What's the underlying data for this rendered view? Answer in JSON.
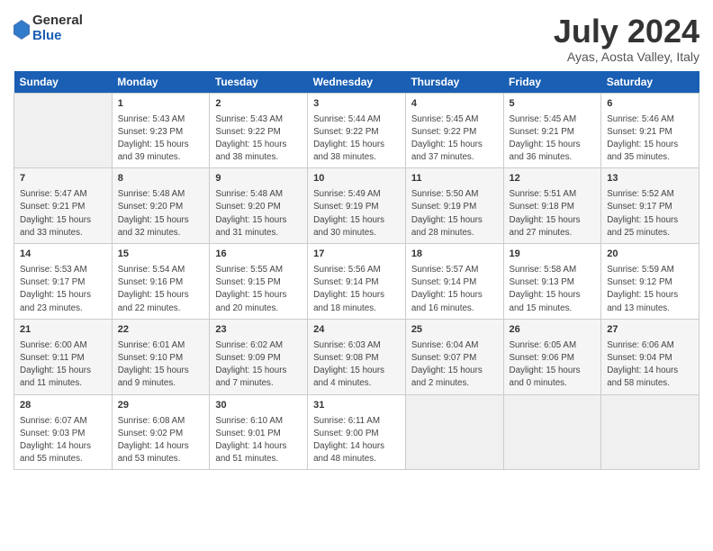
{
  "header": {
    "logo_general": "General",
    "logo_blue": "Blue",
    "title": "July 2024",
    "subtitle": "Ayas, Aosta Valley, Italy"
  },
  "days_of_week": [
    "Sunday",
    "Monday",
    "Tuesday",
    "Wednesday",
    "Thursday",
    "Friday",
    "Saturday"
  ],
  "weeks": [
    [
      {
        "day": "",
        "detail": ""
      },
      {
        "day": "1",
        "detail": "Sunrise: 5:43 AM\nSunset: 9:23 PM\nDaylight: 15 hours\nand 39 minutes."
      },
      {
        "day": "2",
        "detail": "Sunrise: 5:43 AM\nSunset: 9:22 PM\nDaylight: 15 hours\nand 38 minutes."
      },
      {
        "day": "3",
        "detail": "Sunrise: 5:44 AM\nSunset: 9:22 PM\nDaylight: 15 hours\nand 38 minutes."
      },
      {
        "day": "4",
        "detail": "Sunrise: 5:45 AM\nSunset: 9:22 PM\nDaylight: 15 hours\nand 37 minutes."
      },
      {
        "day": "5",
        "detail": "Sunrise: 5:45 AM\nSunset: 9:21 PM\nDaylight: 15 hours\nand 36 minutes."
      },
      {
        "day": "6",
        "detail": "Sunrise: 5:46 AM\nSunset: 9:21 PM\nDaylight: 15 hours\nand 35 minutes."
      }
    ],
    [
      {
        "day": "7",
        "detail": "Sunrise: 5:47 AM\nSunset: 9:21 PM\nDaylight: 15 hours\nand 33 minutes."
      },
      {
        "day": "8",
        "detail": "Sunrise: 5:48 AM\nSunset: 9:20 PM\nDaylight: 15 hours\nand 32 minutes."
      },
      {
        "day": "9",
        "detail": "Sunrise: 5:48 AM\nSunset: 9:20 PM\nDaylight: 15 hours\nand 31 minutes."
      },
      {
        "day": "10",
        "detail": "Sunrise: 5:49 AM\nSunset: 9:19 PM\nDaylight: 15 hours\nand 30 minutes."
      },
      {
        "day": "11",
        "detail": "Sunrise: 5:50 AM\nSunset: 9:19 PM\nDaylight: 15 hours\nand 28 minutes."
      },
      {
        "day": "12",
        "detail": "Sunrise: 5:51 AM\nSunset: 9:18 PM\nDaylight: 15 hours\nand 27 minutes."
      },
      {
        "day": "13",
        "detail": "Sunrise: 5:52 AM\nSunset: 9:17 PM\nDaylight: 15 hours\nand 25 minutes."
      }
    ],
    [
      {
        "day": "14",
        "detail": "Sunrise: 5:53 AM\nSunset: 9:17 PM\nDaylight: 15 hours\nand 23 minutes."
      },
      {
        "day": "15",
        "detail": "Sunrise: 5:54 AM\nSunset: 9:16 PM\nDaylight: 15 hours\nand 22 minutes."
      },
      {
        "day": "16",
        "detail": "Sunrise: 5:55 AM\nSunset: 9:15 PM\nDaylight: 15 hours\nand 20 minutes."
      },
      {
        "day": "17",
        "detail": "Sunrise: 5:56 AM\nSunset: 9:14 PM\nDaylight: 15 hours\nand 18 minutes."
      },
      {
        "day": "18",
        "detail": "Sunrise: 5:57 AM\nSunset: 9:14 PM\nDaylight: 15 hours\nand 16 minutes."
      },
      {
        "day": "19",
        "detail": "Sunrise: 5:58 AM\nSunset: 9:13 PM\nDaylight: 15 hours\nand 15 minutes."
      },
      {
        "day": "20",
        "detail": "Sunrise: 5:59 AM\nSunset: 9:12 PM\nDaylight: 15 hours\nand 13 minutes."
      }
    ],
    [
      {
        "day": "21",
        "detail": "Sunrise: 6:00 AM\nSunset: 9:11 PM\nDaylight: 15 hours\nand 11 minutes."
      },
      {
        "day": "22",
        "detail": "Sunrise: 6:01 AM\nSunset: 9:10 PM\nDaylight: 15 hours\nand 9 minutes."
      },
      {
        "day": "23",
        "detail": "Sunrise: 6:02 AM\nSunset: 9:09 PM\nDaylight: 15 hours\nand 7 minutes."
      },
      {
        "day": "24",
        "detail": "Sunrise: 6:03 AM\nSunset: 9:08 PM\nDaylight: 15 hours\nand 4 minutes."
      },
      {
        "day": "25",
        "detail": "Sunrise: 6:04 AM\nSunset: 9:07 PM\nDaylight: 15 hours\nand 2 minutes."
      },
      {
        "day": "26",
        "detail": "Sunrise: 6:05 AM\nSunset: 9:06 PM\nDaylight: 15 hours\nand 0 minutes."
      },
      {
        "day": "27",
        "detail": "Sunrise: 6:06 AM\nSunset: 9:04 PM\nDaylight: 14 hours\nand 58 minutes."
      }
    ],
    [
      {
        "day": "28",
        "detail": "Sunrise: 6:07 AM\nSunset: 9:03 PM\nDaylight: 14 hours\nand 55 minutes."
      },
      {
        "day": "29",
        "detail": "Sunrise: 6:08 AM\nSunset: 9:02 PM\nDaylight: 14 hours\nand 53 minutes."
      },
      {
        "day": "30",
        "detail": "Sunrise: 6:10 AM\nSunset: 9:01 PM\nDaylight: 14 hours\nand 51 minutes."
      },
      {
        "day": "31",
        "detail": "Sunrise: 6:11 AM\nSunset: 9:00 PM\nDaylight: 14 hours\nand 48 minutes."
      },
      {
        "day": "",
        "detail": ""
      },
      {
        "day": "",
        "detail": ""
      },
      {
        "day": "",
        "detail": ""
      }
    ]
  ]
}
